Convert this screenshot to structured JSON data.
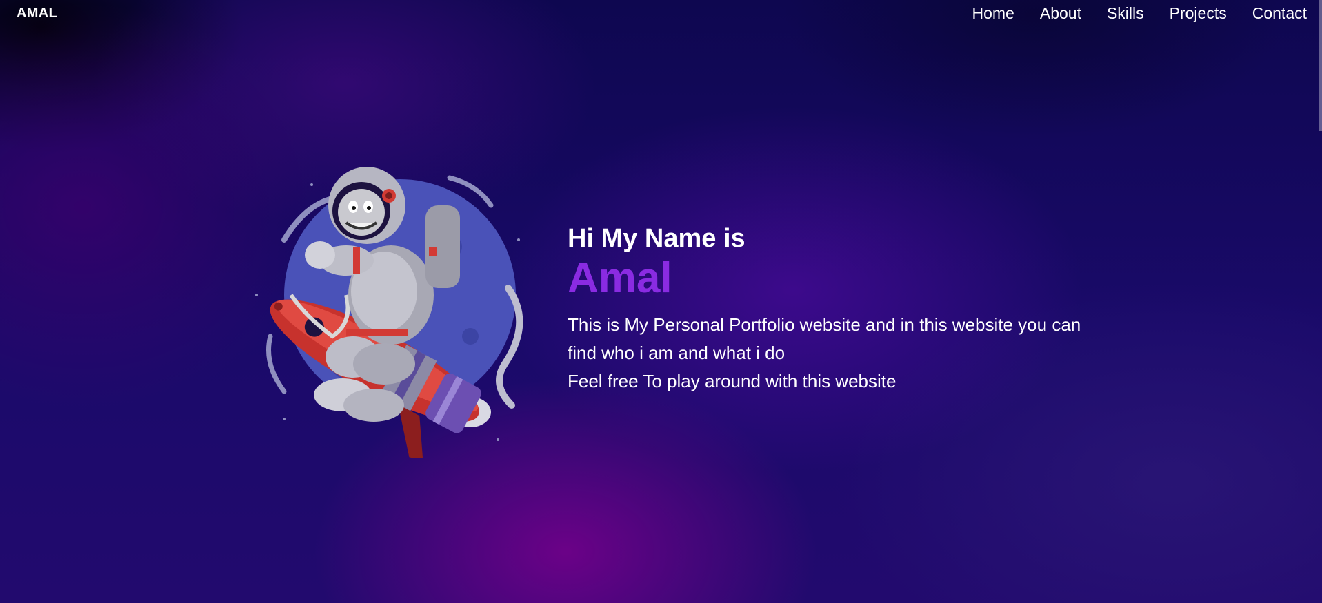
{
  "header": {
    "logo": "AMAL",
    "nav": [
      {
        "label": "Home"
      },
      {
        "label": "About"
      },
      {
        "label": "Skills"
      },
      {
        "label": "Projects"
      },
      {
        "label": "Contact"
      }
    ]
  },
  "hero": {
    "greeting": "Hi My Name is",
    "name": "Amal",
    "description_lines": [
      "This is My Personal Portfolio website and in this website you can find who i am and what i do",
      "Feel free To play around with this website"
    ],
    "image_icon": "astronaut-riding-rocket-illustration"
  },
  "colors": {
    "accent": "#8a2be2",
    "text": "#ffffff",
    "background": "#120a52"
  }
}
